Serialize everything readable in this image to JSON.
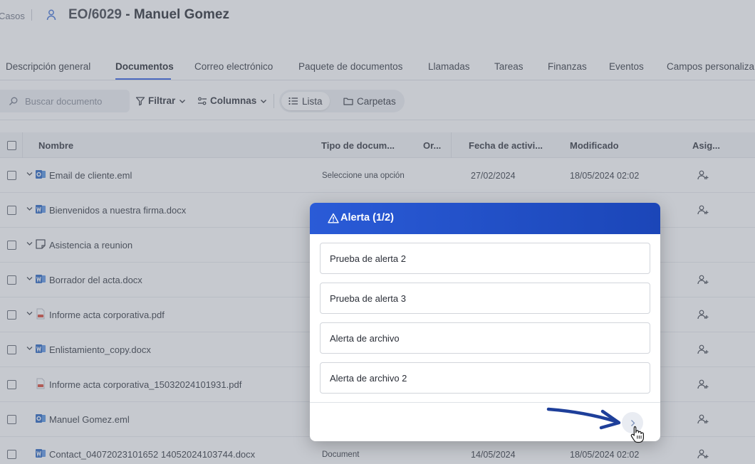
{
  "header": {
    "breadcrumb": "Casos",
    "case_code": "EO/6029",
    "case_name": "- Manuel Gomez"
  },
  "tabs": [
    {
      "label": "Descripción general"
    },
    {
      "label": "Documentos"
    },
    {
      "label": "Correo electrónico"
    },
    {
      "label": "Paquete de documentos"
    },
    {
      "label": "Llamadas"
    },
    {
      "label": "Tareas"
    },
    {
      "label": "Finanzas"
    },
    {
      "label": "Eventos"
    },
    {
      "label": "Campos personaliza"
    }
  ],
  "toolbar": {
    "search_placeholder": "Buscar documento",
    "filter_label": "Filtrar",
    "columns_label": "Columnas",
    "view_list_label": "Lista",
    "view_folders_label": "Carpetas"
  },
  "table": {
    "columns": {
      "name": "Nombre",
      "doc_type": "Tipo de docum...",
      "order": "Or...",
      "activity_date": "Fecha de activi...",
      "modified": "Modificado",
      "assigned": "Asig..."
    },
    "rows": [
      {
        "name": "Email de cliente.eml",
        "doc_type": "Seleccione una opción",
        "activity_date": "27/02/2024",
        "modified": "18/05/2024 02:02"
      },
      {
        "name": "Bienvenidos a nuestra firma.docx",
        "doc_type": "",
        "activity_date": "",
        "modified": ""
      },
      {
        "name": "Asistencia a reunion",
        "doc_type": "",
        "activity_date": "",
        "modified": ""
      },
      {
        "name": "Borrador del acta.docx",
        "doc_type": "",
        "activity_date": "",
        "modified": ""
      },
      {
        "name": "Informe acta corporativa.pdf",
        "doc_type": "",
        "activity_date": "",
        "modified": ""
      },
      {
        "name": "Enlistamiento_copy.docx",
        "doc_type": "",
        "activity_date": "",
        "modified": ""
      },
      {
        "name": "Informe acta corporativa_15032024101931.pdf",
        "doc_type": "",
        "activity_date": "",
        "modified": ""
      },
      {
        "name": "Manuel Gomez.eml",
        "doc_type": "",
        "activity_date": "",
        "modified": ""
      },
      {
        "name": "Contact_04072023101652 14052024103744.docx",
        "doc_type": "Document",
        "activity_date": "14/05/2024",
        "modified": "18/05/2024 02:02"
      }
    ]
  },
  "modal": {
    "title": "Alerta (1/2)",
    "alerts": [
      {
        "text": "Prueba de alerta 2"
      },
      {
        "text": "Prueba de alerta 3"
      },
      {
        "text": "Alerta de archivo"
      },
      {
        "text": "Alerta de archivo 2"
      }
    ]
  },
  "colors": {
    "accent": "#2d5be3",
    "modal_header": "#1f4cc4",
    "annotation_arrow": "#1e3f9a",
    "word_icon": "#1f5fbf",
    "pdf_icon": "#d9432f"
  },
  "icons": {
    "case": "user-icon",
    "search": "search-icon",
    "filter": "filter-icon",
    "columns": "columns-icon",
    "list": "list-icon",
    "folders": "folder-icon",
    "alert": "warning-icon",
    "next": "chevron-right-icon",
    "assign": "add-user-icon"
  }
}
